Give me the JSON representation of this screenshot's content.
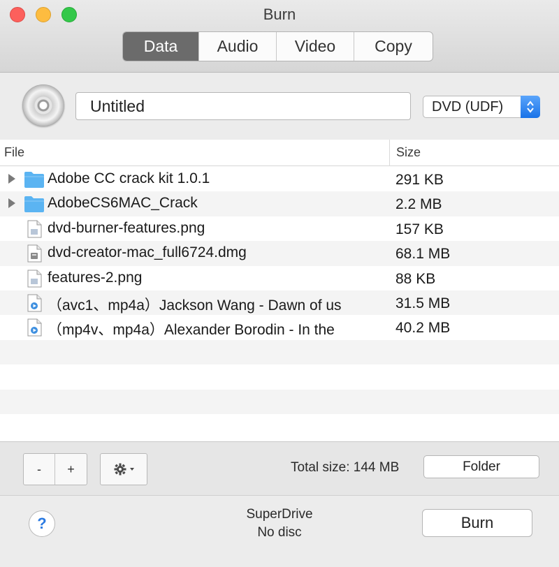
{
  "window": {
    "title": "Burn"
  },
  "tabs": [
    {
      "label": "Data",
      "active": true
    },
    {
      "label": "Audio",
      "active": false
    },
    {
      "label": "Video",
      "active": false
    },
    {
      "label": "Copy",
      "active": false
    }
  ],
  "disc": {
    "name_value": "Untitled",
    "format": "DVD (UDF)"
  },
  "table": {
    "columns": [
      "File",
      "Size"
    ],
    "rows": [
      {
        "type": "folder",
        "name": "Adobe CC crack kit 1.0.1",
        "size": "291 KB",
        "expandable": true
      },
      {
        "type": "folder",
        "name": "AdobeCS6MAC_Crack",
        "size": "2.2 MB",
        "expandable": true
      },
      {
        "type": "image",
        "name": "dvd-burner-features.png",
        "size": "157 KB",
        "expandable": false
      },
      {
        "type": "disk-image",
        "name": "dvd-creator-mac_full6724.dmg",
        "size": "68.1 MB",
        "expandable": false
      },
      {
        "type": "image",
        "name": "features-2.png",
        "size": "88 KB",
        "expandable": false
      },
      {
        "type": "video",
        "name": "（avc1、mp4a）Jackson Wang - Dawn of us",
        "size": "31.5 MB",
        "expandable": false
      },
      {
        "type": "video",
        "name": "（mp4v、mp4a）Alexander Borodin - In the",
        "size": "40.2 MB",
        "expandable": false
      }
    ]
  },
  "toolbar": {
    "remove_label": "-",
    "add_label": "+",
    "total_size": "Total size: 144 MB",
    "folder_label": "Folder"
  },
  "status": {
    "help_label": "?",
    "drive_name": "SuperDrive",
    "drive_status": "No disc",
    "burn_label": "Burn"
  },
  "colors": {
    "tab_active": "#6b6b6b",
    "folder_blue": "#5bb4f2",
    "stepper_blue": "#1a73e8",
    "help_blue": "#2a7ae2"
  }
}
